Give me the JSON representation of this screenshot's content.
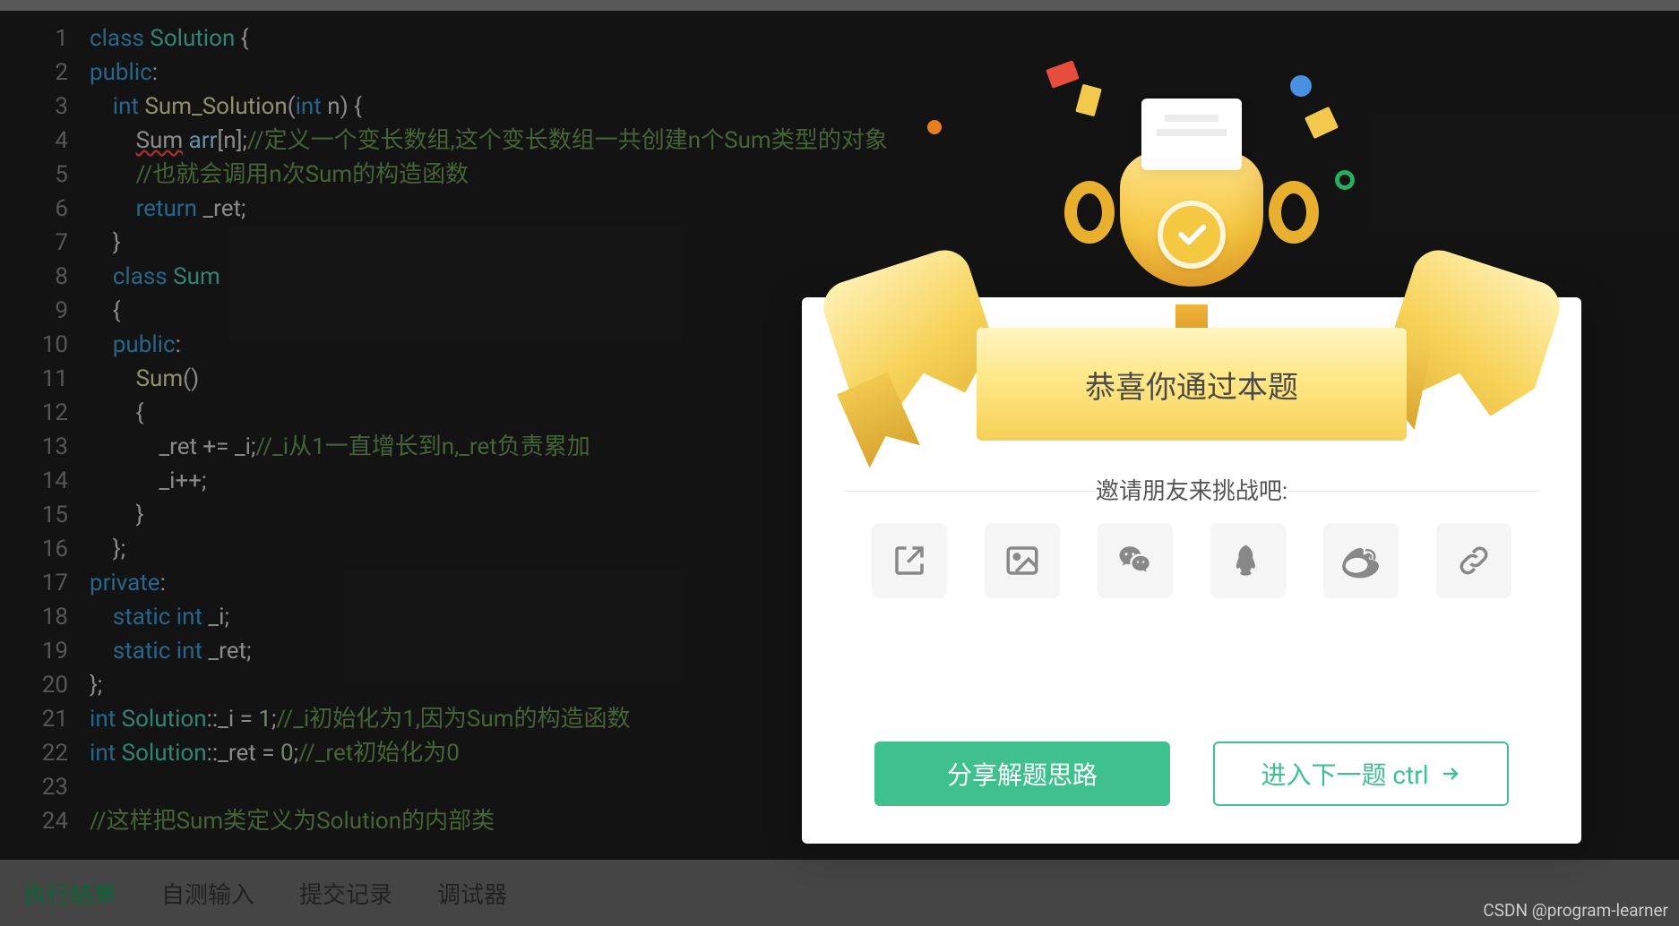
{
  "code": {
    "lines": [
      {
        "n": 1,
        "tokens": [
          [
            "kw",
            "class"
          ],
          [
            "op",
            " "
          ],
          [
            "cls",
            "Solution"
          ],
          [
            "op",
            " {"
          ]
        ]
      },
      {
        "n": 2,
        "tokens": [
          [
            "kw",
            "public"
          ],
          [
            "op",
            ":"
          ]
        ]
      },
      {
        "n": 3,
        "tokens": [
          [
            "op",
            "    "
          ],
          [
            "kw",
            "int"
          ],
          [
            "op",
            " "
          ],
          [
            "fn",
            "Sum_Solution"
          ],
          [
            "op",
            "("
          ],
          [
            "kw",
            "int"
          ],
          [
            "op",
            " n) {"
          ]
        ]
      },
      {
        "n": 4,
        "tokens": [
          [
            "op",
            "        "
          ],
          [
            "err",
            "Sum"
          ],
          [
            "op",
            " "
          ],
          [
            "prop",
            "arr"
          ],
          [
            "op",
            "[n];"
          ],
          [
            "com",
            "//定义一个变长数组,这个变长数组一共创建n个Sum类型的对象"
          ]
        ]
      },
      {
        "n": 5,
        "tokens": [
          [
            "op",
            "        "
          ],
          [
            "com",
            "//也就会调用n次Sum的构造函数"
          ]
        ]
      },
      {
        "n": 6,
        "tokens": [
          [
            "op",
            "        "
          ],
          [
            "kw",
            "return"
          ],
          [
            "op",
            " _ret;"
          ]
        ]
      },
      {
        "n": 7,
        "tokens": [
          [
            "op",
            "    }"
          ]
        ]
      },
      {
        "n": 8,
        "tokens": [
          [
            "op",
            "    "
          ],
          [
            "kw",
            "class"
          ],
          [
            "op",
            " "
          ],
          [
            "cls",
            "Sum"
          ]
        ]
      },
      {
        "n": 9,
        "tokens": [
          [
            "op",
            "    {"
          ]
        ]
      },
      {
        "n": 10,
        "tokens": [
          [
            "op",
            "    "
          ],
          [
            "kw",
            "public"
          ],
          [
            "op",
            ":"
          ]
        ]
      },
      {
        "n": 11,
        "tokens": [
          [
            "op",
            "        "
          ],
          [
            "fn",
            "Sum"
          ],
          [
            "op",
            "()"
          ]
        ]
      },
      {
        "n": 12,
        "tokens": [
          [
            "op",
            "        {"
          ]
        ]
      },
      {
        "n": 13,
        "tokens": [
          [
            "op",
            "            _ret += _i;"
          ],
          [
            "com",
            "//_i从1一直增长到n,_ret负责累加"
          ]
        ]
      },
      {
        "n": 14,
        "tokens": [
          [
            "op",
            "            _i++;"
          ]
        ]
      },
      {
        "n": 15,
        "tokens": [
          [
            "op",
            "        }"
          ]
        ]
      },
      {
        "n": 16,
        "tokens": [
          [
            "op",
            "    };"
          ]
        ]
      },
      {
        "n": 17,
        "tokens": [
          [
            "kw",
            "private"
          ],
          [
            "op",
            ":"
          ]
        ]
      },
      {
        "n": 18,
        "tokens": [
          [
            "op",
            "    "
          ],
          [
            "kw",
            "static"
          ],
          [
            "op",
            " "
          ],
          [
            "kw",
            "int"
          ],
          [
            "op",
            " _i;"
          ]
        ]
      },
      {
        "n": 19,
        "tokens": [
          [
            "op",
            "    "
          ],
          [
            "kw",
            "static"
          ],
          [
            "op",
            " "
          ],
          [
            "kw",
            "int"
          ],
          [
            "op",
            " _ret;"
          ]
        ]
      },
      {
        "n": 20,
        "tokens": [
          [
            "op",
            "};"
          ]
        ]
      },
      {
        "n": 21,
        "tokens": [
          [
            "kw",
            "int"
          ],
          [
            "op",
            " "
          ],
          [
            "cls",
            "Solution"
          ],
          [
            "op",
            "::_i = "
          ],
          [
            "num",
            "1"
          ],
          [
            "op",
            ";"
          ],
          [
            "com",
            "//_i初始化为1,因为Sum的构造函数"
          ]
        ]
      },
      {
        "n": 22,
        "tokens": [
          [
            "kw",
            "int"
          ],
          [
            "op",
            " "
          ],
          [
            "cls",
            "Solution"
          ],
          [
            "op",
            "::_ret = "
          ],
          [
            "num",
            "0"
          ],
          [
            "op",
            ";"
          ],
          [
            "com",
            "//_ret初始化为0"
          ]
        ]
      },
      {
        "n": 23,
        "tokens": [
          [
            "op",
            ""
          ]
        ]
      },
      {
        "n": 24,
        "tokens": [
          [
            "com",
            "//这样把Sum类定义为Solution的内部类"
          ]
        ]
      }
    ]
  },
  "tabs": {
    "result": "执行结果",
    "selftest": "自测输入",
    "submissions": "提交记录",
    "debugger": "调试器"
  },
  "modal": {
    "title": "恭喜你通过本题",
    "invite": "邀请朋友来挑战吧:",
    "share_btn": "分享解题思路",
    "next_btn": "进入下一题 ctrl"
  },
  "share_icons": [
    "open-external",
    "image",
    "wechat",
    "qq",
    "weibo",
    "link"
  ],
  "watermark": "CSDN @program-learner"
}
